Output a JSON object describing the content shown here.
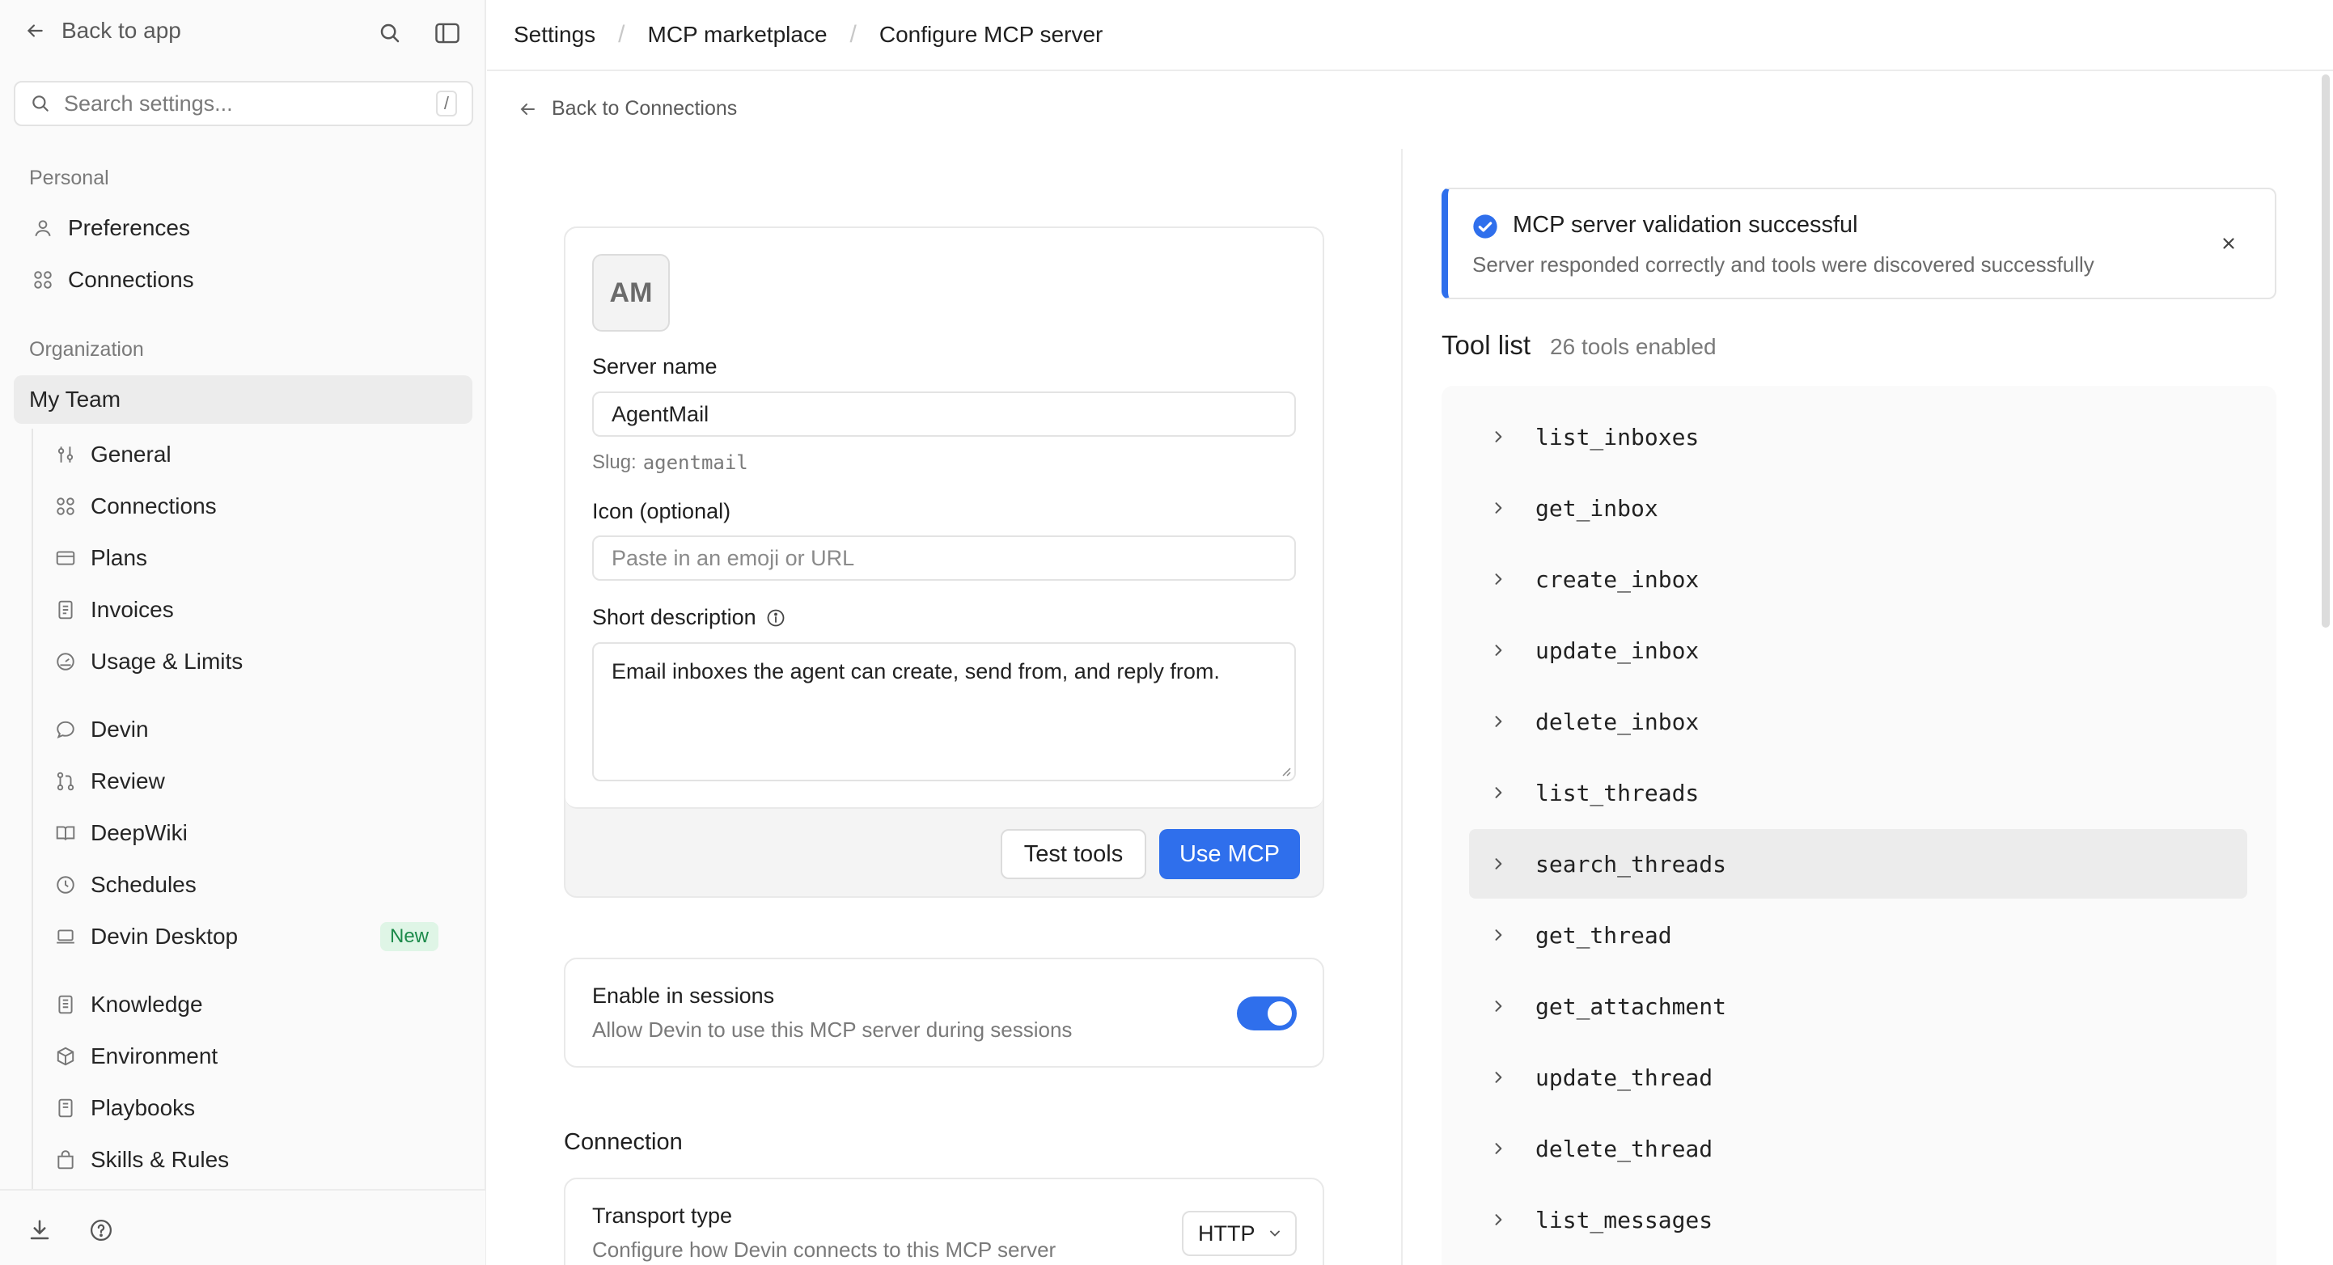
{
  "sidebar": {
    "back_label": "Back to app",
    "search_placeholder": "Search settings...",
    "search_shortcut": "/",
    "personal_heading": "Personal",
    "personal_items": [
      {
        "label": "Preferences",
        "icon": "user-icon"
      },
      {
        "label": "Connections",
        "icon": "grid-icon"
      }
    ],
    "org_heading": "Organization",
    "org_name": "My Team",
    "org_items": [
      {
        "label": "General",
        "icon": "sliders-icon"
      },
      {
        "label": "Connections",
        "icon": "grid-icon"
      },
      {
        "label": "Plans",
        "icon": "card-icon"
      },
      {
        "label": "Invoices",
        "icon": "receipt-icon"
      },
      {
        "label": "Usage & Limits",
        "icon": "gauge-icon"
      },
      {
        "label": "Devin",
        "icon": "chat-icon"
      },
      {
        "label": "Review",
        "icon": "git-pull-icon"
      },
      {
        "label": "DeepWiki",
        "icon": "book-icon"
      },
      {
        "label": "Schedules",
        "icon": "clock-icon"
      },
      {
        "label": "Devin Desktop",
        "icon": "laptop-icon",
        "badge": "New"
      },
      {
        "label": "Knowledge",
        "icon": "doc-icon"
      },
      {
        "label": "Environment",
        "icon": "box-icon"
      },
      {
        "label": "Playbooks",
        "icon": "doc-icon"
      },
      {
        "label": "Skills & Rules",
        "icon": "bag-icon"
      }
    ]
  },
  "header": {
    "crumbs": [
      "Settings",
      "MCP marketplace",
      "Configure MCP server"
    ]
  },
  "back_to_connections": "Back to Connections",
  "form": {
    "avatar_initials": "AM",
    "server_name_label": "Server name",
    "server_name_value": "AgentMail",
    "slug_prefix": "Slug:",
    "slug_value": "agentmail",
    "icon_label": "Icon (optional)",
    "icon_placeholder": "Paste in an emoji or URL",
    "desc_label": "Short description",
    "desc_value": "Email inboxes the agent can create, send from, and reply from.",
    "test_tools_label": "Test tools",
    "use_mcp_label": "Use MCP",
    "enable_title": "Enable in sessions",
    "enable_subtitle": "Allow Devin to use this MCP server during sessions",
    "enable_on": true,
    "connection_heading": "Connection",
    "transport_title": "Transport type",
    "transport_subtitle": "Configure how Devin connects to this MCP server",
    "transport_value": "HTTP"
  },
  "alert": {
    "title": "MCP server validation successful",
    "message": "Server responded correctly and tools were discovered successfully"
  },
  "tools": {
    "heading": "Tool list",
    "count_label": "26 tools enabled",
    "items": [
      "list_inboxes",
      "get_inbox",
      "create_inbox",
      "update_inbox",
      "delete_inbox",
      "list_threads",
      "search_threads",
      "get_thread",
      "get_attachment",
      "update_thread",
      "delete_thread",
      "list_messages"
    ],
    "hovered_index": 6
  },
  "colors": {
    "accent": "#2f6fec",
    "badge_green": "#1c8a4a"
  }
}
